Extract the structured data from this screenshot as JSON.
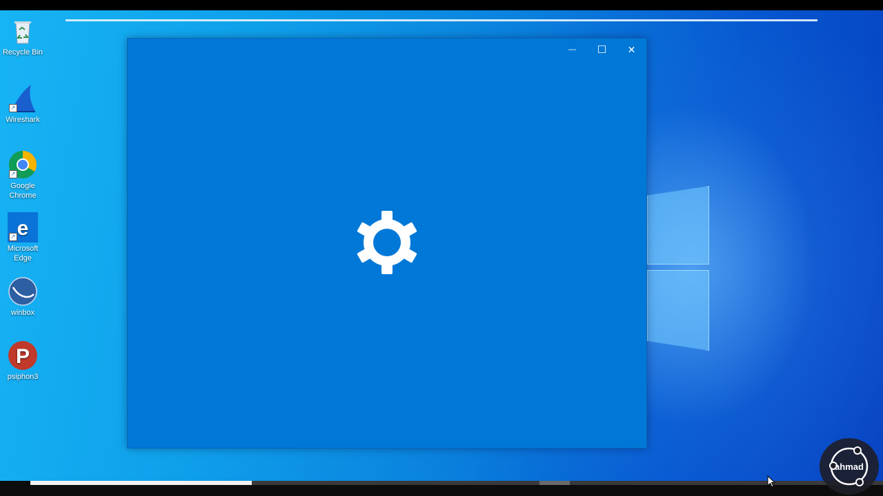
{
  "desktop": {
    "icons": [
      {
        "label": "Recycle Bin",
        "icon": "recycle-bin-icon"
      },
      {
        "label": "Wireshark",
        "icon": "wireshark-icon"
      },
      {
        "label": "Google Chrome",
        "icon": "chrome-icon"
      },
      {
        "label": "Microsoft Edge",
        "icon": "edge-icon"
      },
      {
        "label": "winbox",
        "icon": "winbox-icon"
      },
      {
        "label": "psiphon3",
        "icon": "psiphon-icon"
      }
    ]
  },
  "window": {
    "title": "",
    "background": "#0078d7",
    "minimize_glyph": "—",
    "maximize_glyph": "☐",
    "close_glyph": "✕",
    "center_icon": "gear-icon"
  },
  "video": {
    "progress": 0.26
  },
  "watermark": {
    "label": "ahmad"
  }
}
